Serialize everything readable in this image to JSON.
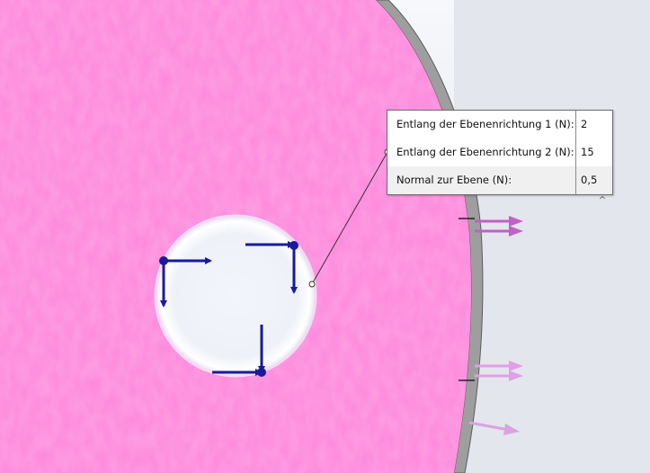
{
  "callout": {
    "rows": [
      {
        "label": "Entlang der Ebenenrichtung 1 (N):",
        "value": "2"
      },
      {
        "label": "Entlang der Ebenenrichtung 2 (N):",
        "value": "15"
      },
      {
        "label": "Normal zur Ebene (N):",
        "value": "0,5"
      }
    ]
  },
  "icons": {
    "collapse": "chevron-up-icon",
    "collapse_glyph": "⌃"
  },
  "colors": {
    "face": "#fe86dc",
    "hole": "#eef2f8",
    "edge": "#9a9a9a",
    "arrow_dark": "#1a1a9a",
    "arrow_magenta": "#c060c8",
    "arrow_pink": "#e0a0e6"
  }
}
